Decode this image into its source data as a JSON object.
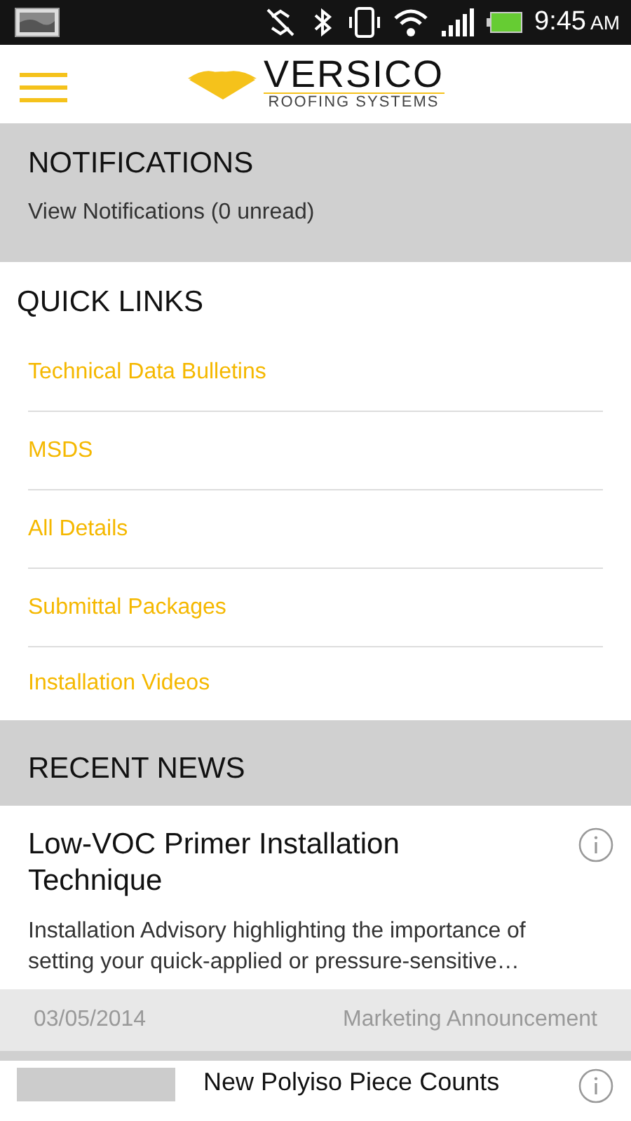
{
  "status_bar": {
    "time": "9:45",
    "am_pm": "AM"
  },
  "header": {
    "logo_name": "VERSICO",
    "logo_tagline": "ROOFING SYSTEMS"
  },
  "notifications": {
    "title": "NOTIFICATIONS",
    "link": "View Notifications (0 unread)"
  },
  "quick_links": {
    "title": "QUICK LINKS",
    "items": [
      {
        "label": "Technical Data Bulletins"
      },
      {
        "label": "MSDS"
      },
      {
        "label": "All Details"
      },
      {
        "label": "Submittal Packages"
      },
      {
        "label": "Installation Videos"
      }
    ]
  },
  "recent_news": {
    "title": "RECENT NEWS",
    "items": [
      {
        "kind": "text",
        "title": "Low-VOC Primer Installation Technique",
        "summary": "Installation Advisory highlighting the importance of setting your quick-applied or pressure-sensitive…",
        "date": "03/05/2014",
        "category": "Marketing Announcement"
      },
      {
        "kind": "thumbnail",
        "title": "New Polyiso Piece Counts"
      }
    ]
  }
}
